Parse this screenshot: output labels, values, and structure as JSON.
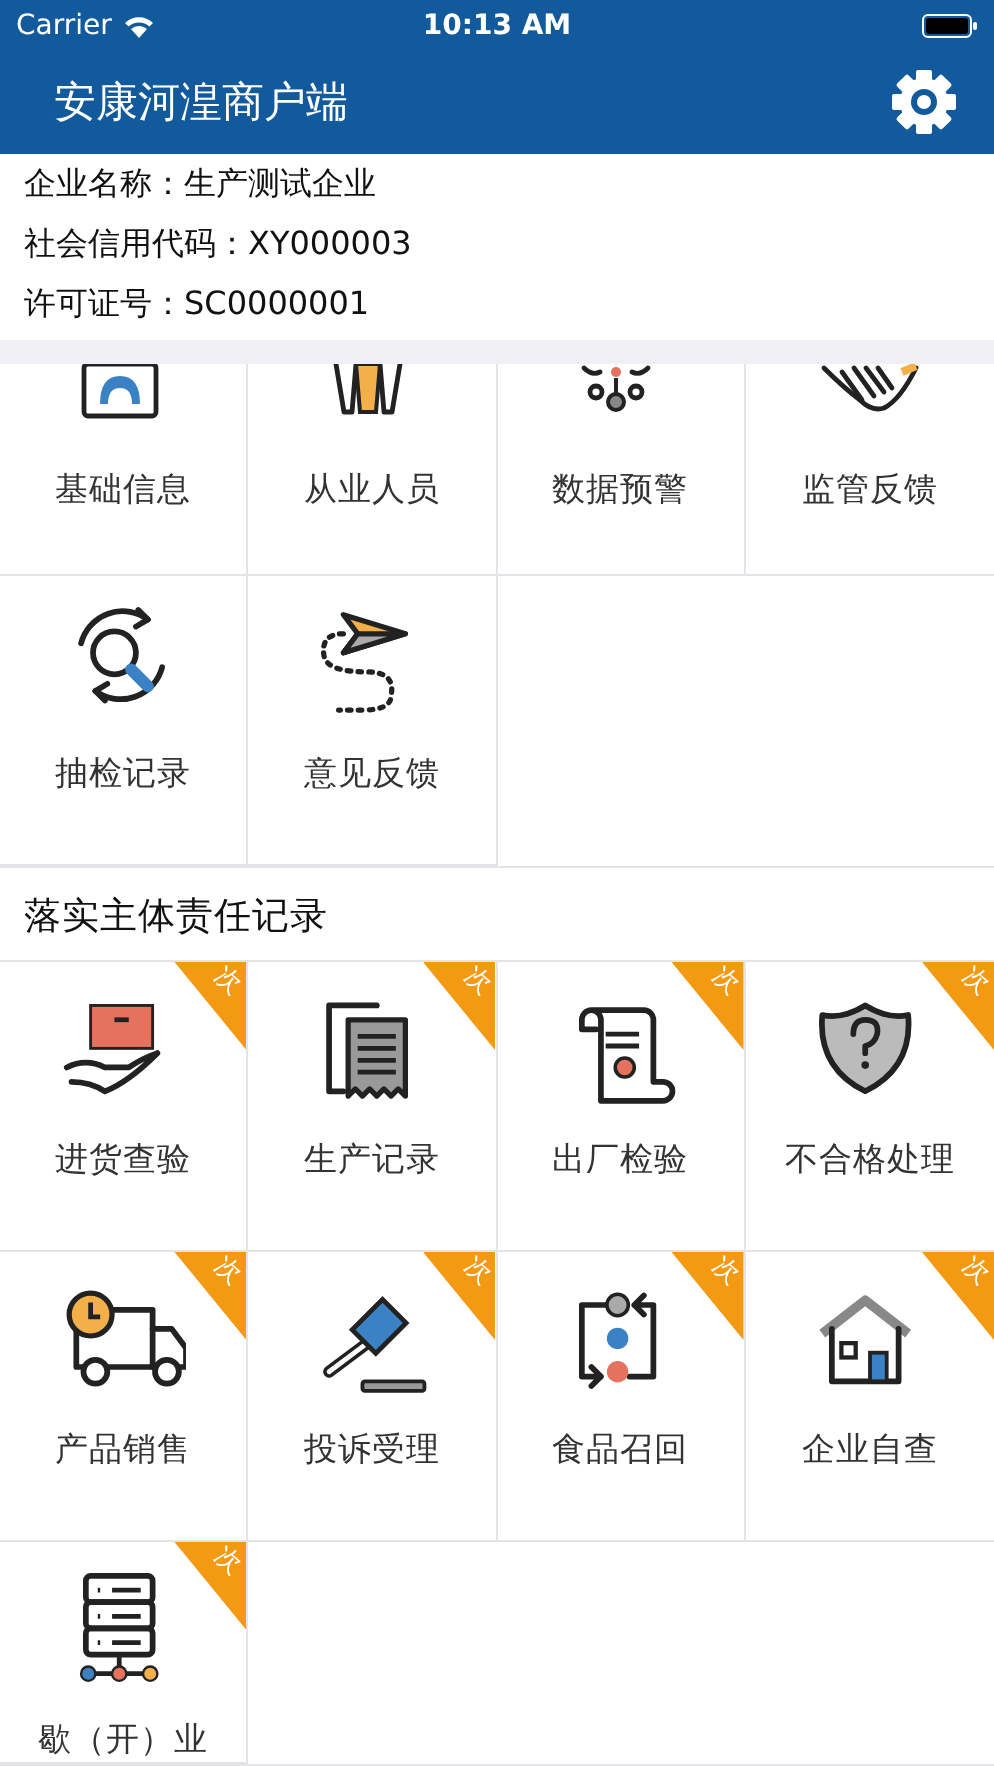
{
  "status_bar": {
    "carrier": "Carrier",
    "time": "10:13 AM"
  },
  "nav_bar": {
    "title": "安康河湟商户端"
  },
  "company": {
    "lines": [
      {
        "label": "企业名称：",
        "value": "生产测试企业"
      },
      {
        "label": "社会信用代码：",
        "value": "XY000003"
      },
      {
        "label": "许可证号：",
        "value": "SC0000001"
      }
    ]
  },
  "functions": [
    {
      "label": "基础信息"
    },
    {
      "label": "从业人员"
    },
    {
      "label": "数据预警"
    },
    {
      "label": "监管反馈"
    },
    {
      "label": "抽检记录"
    },
    {
      "label": "意见反馈"
    }
  ],
  "responsibility": {
    "title": "落实主体责任记录",
    "items": [
      {
        "label": "进货查验",
        "badge": "次"
      },
      {
        "label": "生产记录",
        "badge": "次"
      },
      {
        "label": "出厂检验",
        "badge": "次"
      },
      {
        "label": "不合格处理",
        "badge": "次"
      },
      {
        "label": "产品销售",
        "badge": "次"
      },
      {
        "label": "投诉受理",
        "badge": "次"
      },
      {
        "label": "食品召回",
        "badge": "次"
      },
      {
        "label": "企业自查",
        "badge": "次"
      },
      {
        "label": "歇（开）业",
        "badge": "次"
      }
    ]
  }
}
